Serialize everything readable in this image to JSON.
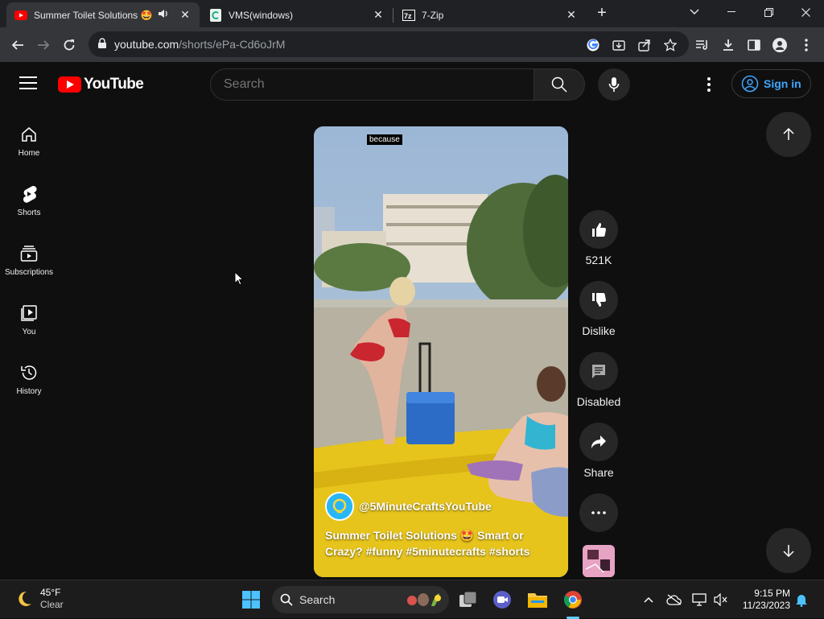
{
  "browser": {
    "tabs": [
      {
        "title": "Summer Toilet Solutions 🤩",
        "active": true
      },
      {
        "title": "VMS(windows)",
        "active": false
      },
      {
        "title": "7-Zip",
        "active": false
      }
    ],
    "url_host": "youtube.com",
    "url_path": "/shorts/ePa-Cd6oJrM"
  },
  "youtube": {
    "logo_text": "YouTube",
    "search_placeholder": "Search",
    "sign_in": "Sign in",
    "sidebar": [
      {
        "label": "Home",
        "icon": "home-icon"
      },
      {
        "label": "Shorts",
        "icon": "shorts-icon"
      },
      {
        "label": "Subscriptions",
        "icon": "subscriptions-icon"
      },
      {
        "label": "You",
        "icon": "library-icon"
      },
      {
        "label": "History",
        "icon": "history-icon"
      }
    ],
    "short": {
      "caption": "because",
      "channel": "@5MinuteCraftsYouTube",
      "title": "Summer Toilet Solutions 🤩 Smart or Crazy? #funny #5minutecrafts #shorts"
    },
    "actions": {
      "likes": "521K",
      "dislike": "Dislike",
      "comments": "Disabled",
      "share": "Share"
    }
  },
  "taskbar": {
    "temperature": "45°F",
    "condition": "Clear",
    "search": "Search",
    "time": "9:15 PM",
    "date": "11/23/2023"
  },
  "colors": {
    "youtube_red": "#ff0000",
    "link_blue": "#3ea6ff",
    "bg": "#0f0f0f"
  }
}
